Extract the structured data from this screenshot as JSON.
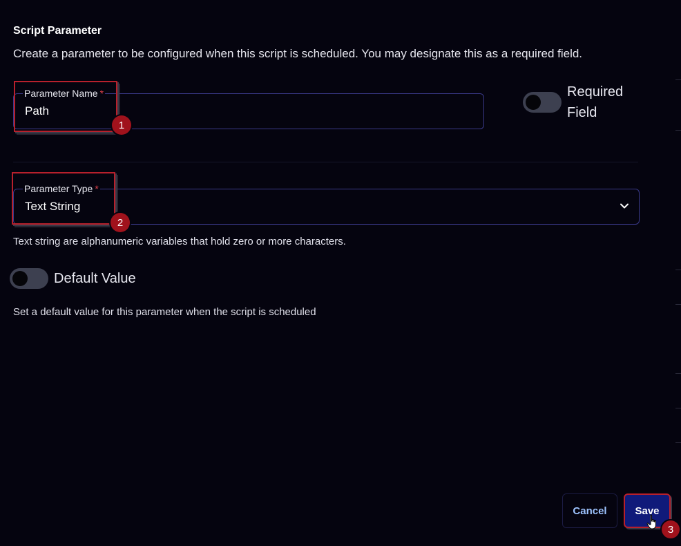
{
  "dialog": {
    "title": "Script Parameter",
    "description": "Create a parameter to be configured when this script is scheduled. You may designate this as a required field."
  },
  "parameter_name": {
    "label": "Parameter Name",
    "required_mark": "*",
    "value": "Path"
  },
  "required_field": {
    "label_line1": "Required",
    "label_line2": "Field",
    "enabled": false
  },
  "parameter_type": {
    "label": "Parameter Type",
    "required_mark": "*",
    "selected": "Text String",
    "helper": "Text string are alphanumeric variables that hold zero or more characters."
  },
  "default_value": {
    "label": "Default Value",
    "enabled": false,
    "helper": "Set a default value for this parameter when the script is scheduled"
  },
  "actions": {
    "cancel_label": "Cancel",
    "save_label": "Save"
  },
  "annotations": {
    "step1": "1",
    "step2": "2",
    "step3": "3"
  },
  "colors": {
    "background": "#05040f",
    "field_border": "#3a3a8a",
    "highlight": "#b8202c",
    "badge": "#a0121c",
    "save_button": "#101a7a",
    "cancel_text": "#9ec4ff"
  }
}
